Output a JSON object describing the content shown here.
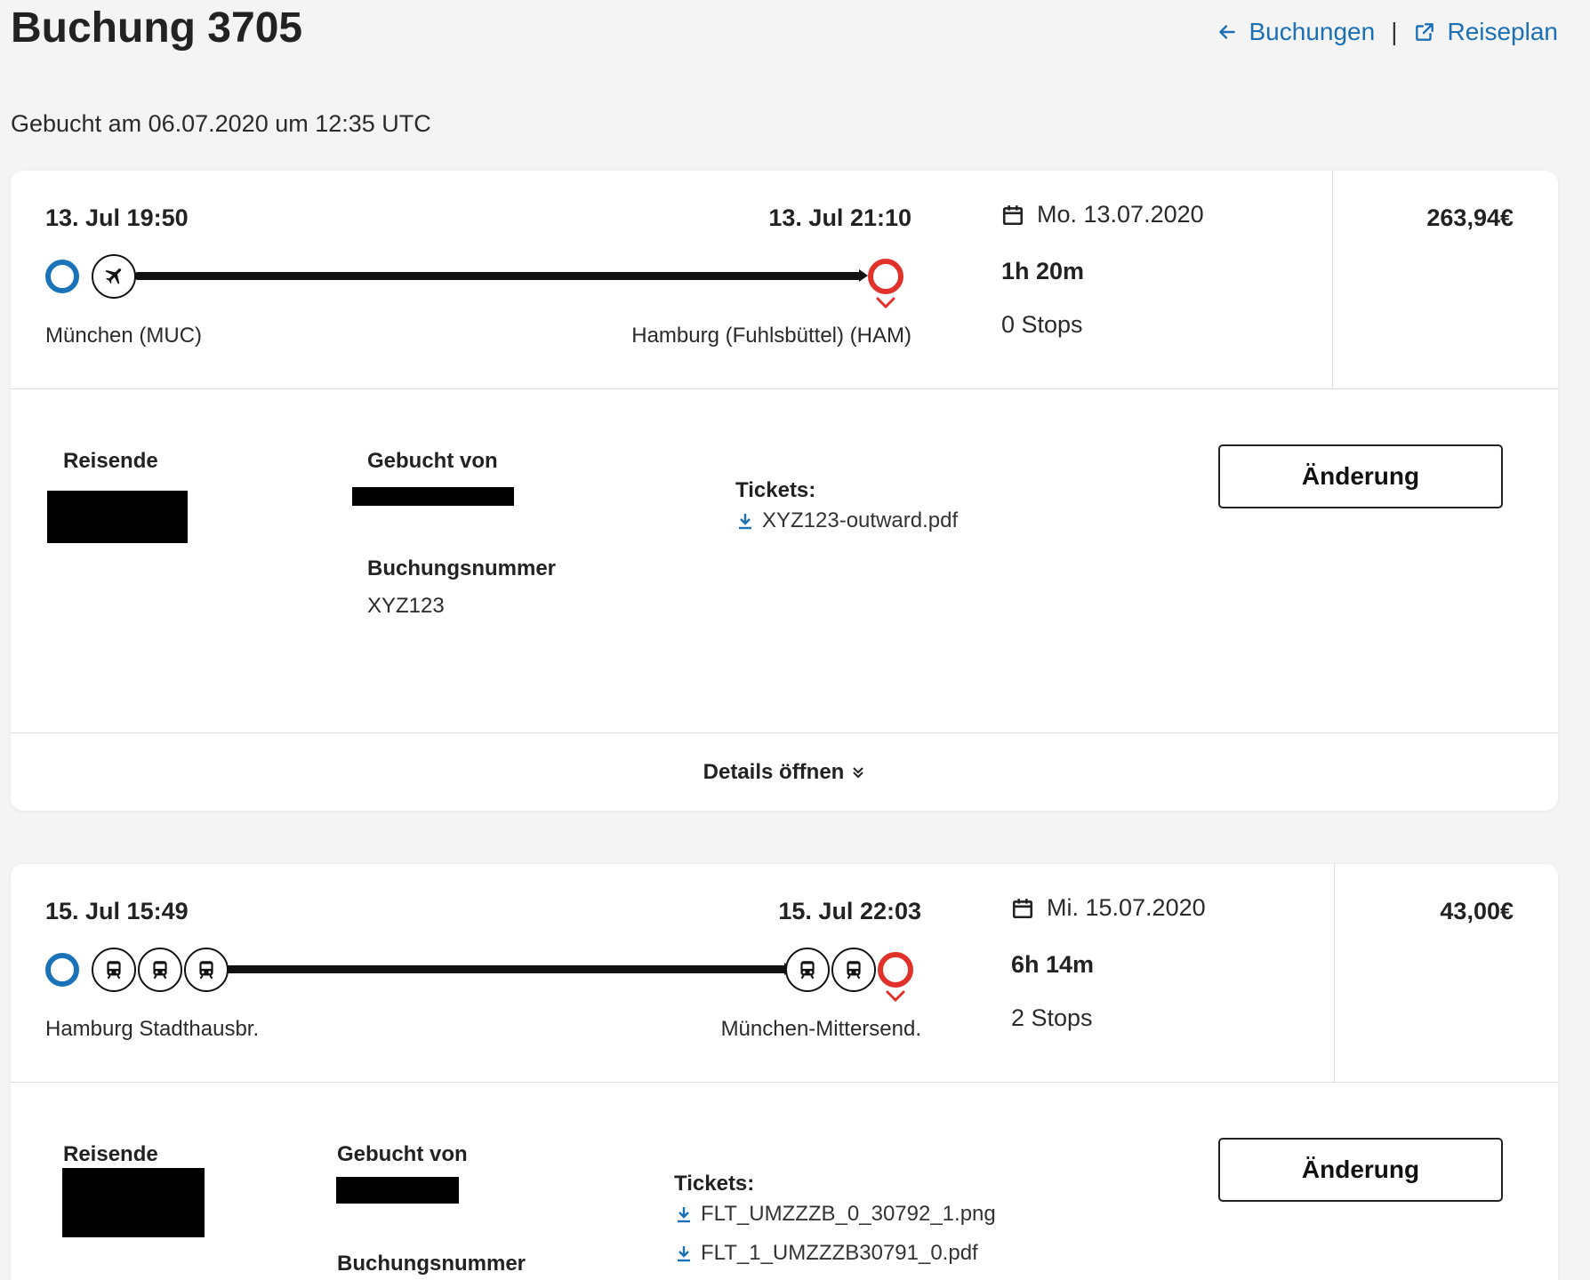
{
  "header": {
    "title": "Buchung 3705",
    "back_label": "Buchungen",
    "itinerary_label": "Reiseplan",
    "separator": "|",
    "booked_at": "Gebucht am 06.07.2020 um 12:35 UTC"
  },
  "colors": {
    "accent": "#1a6fb5",
    "origin": "#1a73b8",
    "destination": "#e0322a"
  },
  "bookings": [
    {
      "departure_time": "13. Jul 19:50",
      "arrival_time": "13. Jul 21:10",
      "origin": "München (MUC)",
      "destination": "Hamburg (Fuhlsbüttel) (HAM)",
      "date": "Mo. 13.07.2020",
      "duration": "1h 20m",
      "stops": "0 Stops",
      "price": "263,94€",
      "mode_icons": [
        "plane-icon"
      ],
      "travellers_label": "Reisende",
      "booked_by_label": "Gebucht von",
      "booking_number_label": "Buchungsnummer",
      "booking_number": "XYZ123",
      "tickets_label": "Tickets:",
      "tickets": [
        "XYZ123-outward.pdf"
      ],
      "change_label": "Änderung",
      "details_label": "Details öffnen"
    },
    {
      "departure_time": "15. Jul 15:49",
      "arrival_time": "15. Jul 22:03",
      "origin": "Hamburg Stadthausbr.",
      "destination": "München-Mittersend.",
      "date": "Mi. 15.07.2020",
      "duration": "6h 14m",
      "stops": "2 Stops",
      "price": "43,00€",
      "mode_icons": [
        "train-icon",
        "train-icon",
        "train-icon",
        "train-icon",
        "train-icon"
      ],
      "travellers_label": "Reisende",
      "booked_by_label": "Gebucht von",
      "booking_number_label": "Buchungsnummer",
      "tickets_label": "Tickets:",
      "tickets": [
        "FLT_UMZZZB_0_30792_1.png",
        "FLT_1_UMZZZB30791_0.pdf"
      ],
      "change_label": "Änderung"
    }
  ]
}
